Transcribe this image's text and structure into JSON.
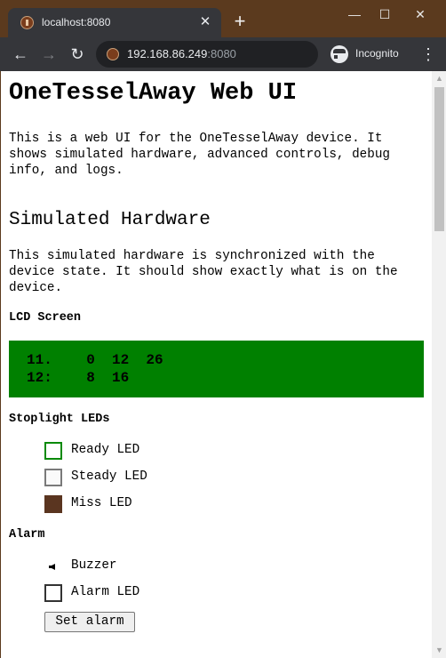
{
  "browser": {
    "tab_title": "localhost:8080",
    "tab_close": "✕",
    "new_tab": "+",
    "window_min": "—",
    "window_max": "☐",
    "window_close": "✕",
    "url_host": "192.168.86.249",
    "url_port": ":8080",
    "incognito_label": "Incognito",
    "nav_back": "←",
    "nav_forward": "→",
    "nav_reload": "↻",
    "menu": "⋮"
  },
  "page": {
    "title": "OneTesselAway Web UI",
    "intro": "This is a web UI for the OneTesselAway device. It shows simulated hardware, advanced controls, debug info, and logs.",
    "sim_heading": "Simulated Hardware",
    "sim_desc": "This simulated hardware is synchronized with the device state. It should show exactly what is on the device.",
    "lcd_label": "LCD Screen",
    "lcd_line1": "11.    0  12  26",
    "lcd_line2": "12:    8  16",
    "stoplight_label": "Stoplight LEDs",
    "leds": {
      "ready": "Ready LED",
      "steady": "Steady LED",
      "miss": "Miss LED"
    },
    "alarm_label": "Alarm",
    "buzzer": "Buzzer",
    "alarm_led": "Alarm LED",
    "set_alarm": "Set alarm"
  },
  "colors": {
    "lcd_background": "#008000",
    "ready_led_border": "#0a8a0a",
    "miss_led_fill": "#5a3520",
    "window_frame": "#5b3a1e"
  },
  "icons": {
    "tab_favicon": "site-favicon-icon",
    "buzzer": "speaker-icon",
    "incognito": "incognito-icon"
  }
}
